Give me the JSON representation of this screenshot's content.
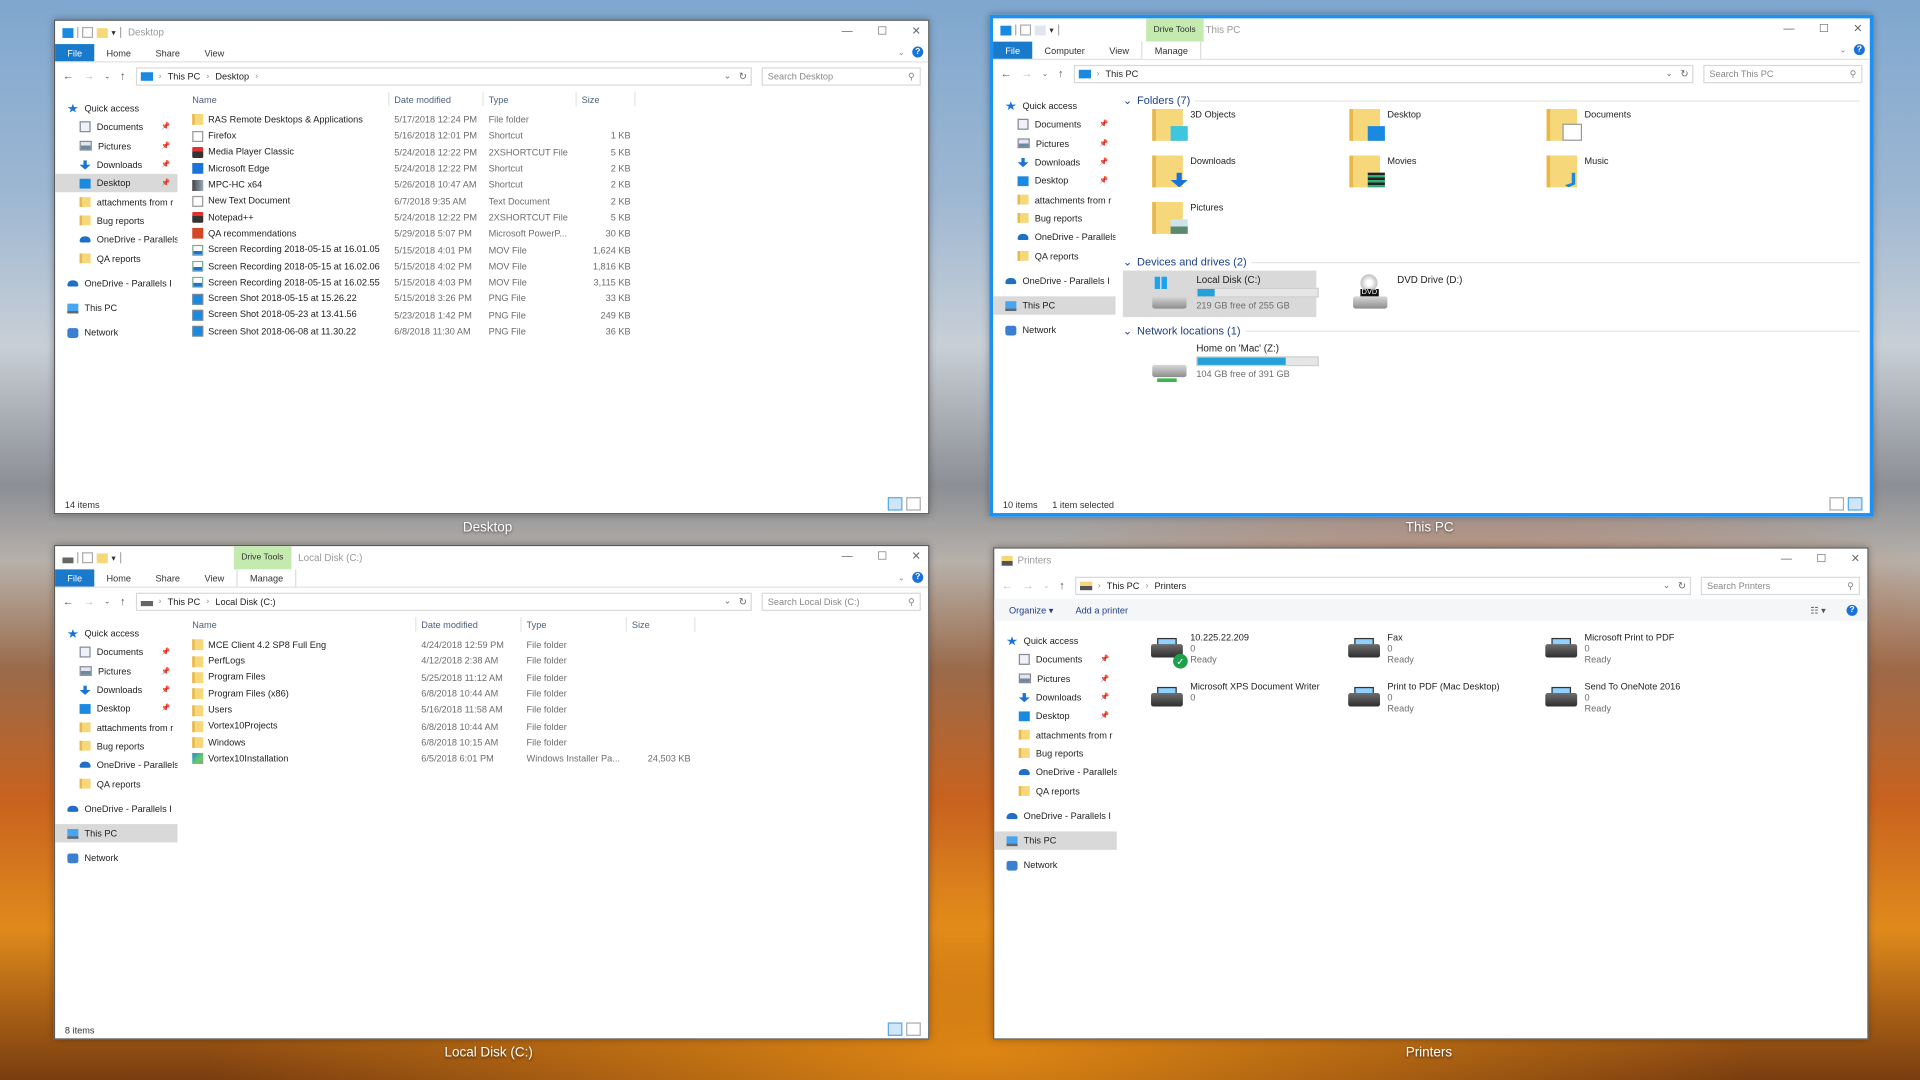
{
  "colors": {
    "accent": "#1979ca",
    "active_border": "#1e90f0",
    "drive_tools_bg": "#c4eab0",
    "bar_fill": "#26a0da"
  },
  "common": {
    "file_tab": "File",
    "this_pc": "This PC",
    "sidebar": [
      {
        "label": "Quick access",
        "icon": "star-icon",
        "level": "top",
        "pinned": false
      },
      {
        "label": "Documents",
        "icon": "documents-icon",
        "level": "l1",
        "pinned": true
      },
      {
        "label": "Pictures",
        "icon": "pictures-icon",
        "level": "l1",
        "pinned": true
      },
      {
        "label": "Downloads",
        "icon": "download-icon",
        "level": "l1",
        "pinned": true
      },
      {
        "label": "Desktop",
        "icon": "desktop-icon",
        "level": "l1",
        "pinned": true
      },
      {
        "label": "attachments from r",
        "icon": "folder-icon",
        "level": "l1",
        "pinned": false
      },
      {
        "label": "Bug reports",
        "icon": "folder-icon",
        "level": "l1",
        "pinned": false
      },
      {
        "label": "OneDrive - Parallels",
        "icon": "onedrive-icon",
        "level": "l1",
        "pinned": false
      },
      {
        "label": "QA reports",
        "icon": "folder-icon",
        "level": "l1",
        "pinned": false
      },
      {
        "label": "OneDrive - Parallels I",
        "icon": "onedrive-icon",
        "level": "top",
        "pinned": false
      },
      {
        "label": "This PC",
        "icon": "pc-icon",
        "level": "top",
        "pinned": false
      },
      {
        "label": "Network",
        "icon": "network-icon",
        "level": "top",
        "pinned": false
      }
    ]
  },
  "desktop_window": {
    "caption": "Desktop",
    "title": "Desktop",
    "tabs": [
      "Home",
      "Share",
      "View"
    ],
    "breadcrumb": [
      "This PC",
      "Desktop"
    ],
    "search_placeholder": "Search Desktop",
    "columns": [
      "Name",
      "Date modified",
      "Type",
      "Size"
    ],
    "files": [
      {
        "name": "RAS Remote Desktops & Applications",
        "date": "5/17/2018 12:24 PM",
        "type": "File folder",
        "size": "",
        "icon": "folder"
      },
      {
        "name": "Firefox",
        "date": "5/16/2018 12:01 PM",
        "type": "Shortcut",
        "size": "1 KB",
        "icon": "shortcut"
      },
      {
        "name": "Media Player Classic",
        "date": "5/24/2018 12:22 PM",
        "type": "2XSHORTCUT File",
        "size": "5 KB",
        "icon": "app-red"
      },
      {
        "name": "Microsoft Edge",
        "date": "5/24/2018 12:22 PM",
        "type": "Shortcut",
        "size": "2 KB",
        "icon": "edge"
      },
      {
        "name": "MPC-HC x64",
        "date": "5/26/2018 10:47 AM",
        "type": "Shortcut",
        "size": "2 KB",
        "icon": "mpc"
      },
      {
        "name": "New Text Document",
        "date": "6/7/2018 9:35 AM",
        "type": "Text Document",
        "size": "2 KB",
        "icon": "text"
      },
      {
        "name": "Notepad++",
        "date": "5/24/2018 12:22 PM",
        "type": "2XSHORTCUT File",
        "size": "5 KB",
        "icon": "app-red"
      },
      {
        "name": "QA recommendations",
        "date": "5/29/2018 5:07 PM",
        "type": "Microsoft PowerP...",
        "size": "30 KB",
        "icon": "ppt"
      },
      {
        "name": "Screen Recording 2018-05-15 at 16.01.05",
        "date": "5/15/2018 4:01 PM",
        "type": "MOV File",
        "size": "1,624 KB",
        "icon": "mov"
      },
      {
        "name": "Screen Recording 2018-05-15 at 16.02.06",
        "date": "5/15/2018 4:02 PM",
        "type": "MOV File",
        "size": "1,816 KB",
        "icon": "mov"
      },
      {
        "name": "Screen Recording 2018-05-15 at 16.02.55",
        "date": "5/15/2018 4:03 PM",
        "type": "MOV File",
        "size": "3,115 KB",
        "icon": "mov"
      },
      {
        "name": "Screen Shot 2018-05-15 at 15.26.22",
        "date": "5/15/2018 3:26 PM",
        "type": "PNG File",
        "size": "33 KB",
        "icon": "png"
      },
      {
        "name": "Screen Shot 2018-05-23 at 13.41.56",
        "date": "5/23/2018 1:42 PM",
        "type": "PNG File",
        "size": "249 KB",
        "icon": "png"
      },
      {
        "name": "Screen Shot 2018-06-08 at 11.30.22",
        "date": "6/8/2018 11:30 AM",
        "type": "PNG File",
        "size": "36 KB",
        "icon": "png"
      }
    ],
    "status": "14 items",
    "selected_sidebar": "Desktop"
  },
  "thispc_window": {
    "caption": "This PC",
    "title": "This PC",
    "context_tab": "Drive Tools",
    "tabs": [
      "Computer",
      "View",
      "Manage"
    ],
    "breadcrumb": [
      "This PC"
    ],
    "search_placeholder": "Search This PC",
    "folders_header": "Folders (7)",
    "folders": [
      {
        "name": "3D Objects",
        "icon": "3d-objects"
      },
      {
        "name": "Desktop",
        "icon": "desktop"
      },
      {
        "name": "Documents",
        "icon": "documents"
      },
      {
        "name": "Downloads",
        "icon": "downloads"
      },
      {
        "name": "Movies",
        "icon": "movies"
      },
      {
        "name": "Music",
        "icon": "music"
      },
      {
        "name": "Pictures",
        "icon": "pictures"
      }
    ],
    "drives_header": "Devices and drives (2)",
    "drives": [
      {
        "name": "Local Disk (C:)",
        "free_text": "219 GB free of 255 GB",
        "used_fraction": 0.14,
        "selected": true
      },
      {
        "name": "DVD Drive (D:)",
        "free_text": "",
        "used_fraction": null,
        "selected": false,
        "badge": "DVD"
      }
    ],
    "network_header": "Network locations (1)",
    "network": [
      {
        "name": "Home on 'Mac' (Z:)",
        "free_text": "104 GB free of 391 GB",
        "used_fraction": 0.73
      }
    ],
    "status": "10 items",
    "status_selected": "1 item selected",
    "selected_sidebar": "This PC"
  },
  "localdisk_window": {
    "caption": "Local Disk (C:)",
    "title": "Local Disk (C:)",
    "context_tab": "Drive Tools",
    "tabs": [
      "Home",
      "Share",
      "View",
      "Manage"
    ],
    "breadcrumb": [
      "This PC",
      "Local Disk (C:)"
    ],
    "search_placeholder": "Search Local Disk (C:)",
    "columns": [
      "Name",
      "Date modified",
      "Type",
      "Size"
    ],
    "files": [
      {
        "name": "MCE Client 4.2 SP8 Full Eng",
        "date": "4/24/2018 12:59 PM",
        "type": "File folder",
        "size": "",
        "icon": "folder"
      },
      {
        "name": "PerfLogs",
        "date": "4/12/2018 2:38 AM",
        "type": "File folder",
        "size": "",
        "icon": "folder"
      },
      {
        "name": "Program Files",
        "date": "5/25/2018 11:12 AM",
        "type": "File folder",
        "size": "",
        "icon": "folder"
      },
      {
        "name": "Program Files (x86)",
        "date": "6/8/2018 10:44 AM",
        "type": "File folder",
        "size": "",
        "icon": "folder"
      },
      {
        "name": "Users",
        "date": "5/16/2018 11:58 AM",
        "type": "File folder",
        "size": "",
        "icon": "folder"
      },
      {
        "name": "Vortex10Projects",
        "date": "6/8/2018 10:44 AM",
        "type": "File folder",
        "size": "",
        "icon": "folder"
      },
      {
        "name": "Windows",
        "date": "6/8/2018 10:15 AM",
        "type": "File folder",
        "size": "",
        "icon": "folder"
      },
      {
        "name": "Vortex10Installation",
        "date": "6/5/2018 6:01 PM",
        "type": "Windows Installer Pa...",
        "size": "24,503 KB",
        "icon": "msi"
      }
    ],
    "status": "8 items",
    "selected_sidebar": "This PC"
  },
  "printers_window": {
    "caption": "Printers",
    "title": "Printers",
    "breadcrumb": [
      "This PC",
      "Printers"
    ],
    "search_placeholder": "Search Printers",
    "commands": [
      "Organize ▾",
      "Add a printer"
    ],
    "printers": [
      {
        "name": "10.225.22.209",
        "line2": "0",
        "line3": "Ready",
        "default": true,
        "icon": "printer"
      },
      {
        "name": "Fax",
        "line2": "0",
        "line3": "Ready",
        "default": false,
        "icon": "fax"
      },
      {
        "name": "Microsoft Print to PDF",
        "line2": "0",
        "line3": "Ready",
        "default": false,
        "icon": "printer"
      },
      {
        "name": "Microsoft XPS Document Writer",
        "line2": "0",
        "line3": "",
        "default": false,
        "icon": "printer"
      },
      {
        "name": "Print to PDF (Mac Desktop)",
        "line2": "0",
        "line3": "Ready",
        "default": false,
        "icon": "printer"
      },
      {
        "name": "Send To OneNote 2016",
        "line2": "0",
        "line3": "Ready",
        "default": false,
        "icon": "printer"
      }
    ],
    "selected_sidebar": "This PC"
  }
}
